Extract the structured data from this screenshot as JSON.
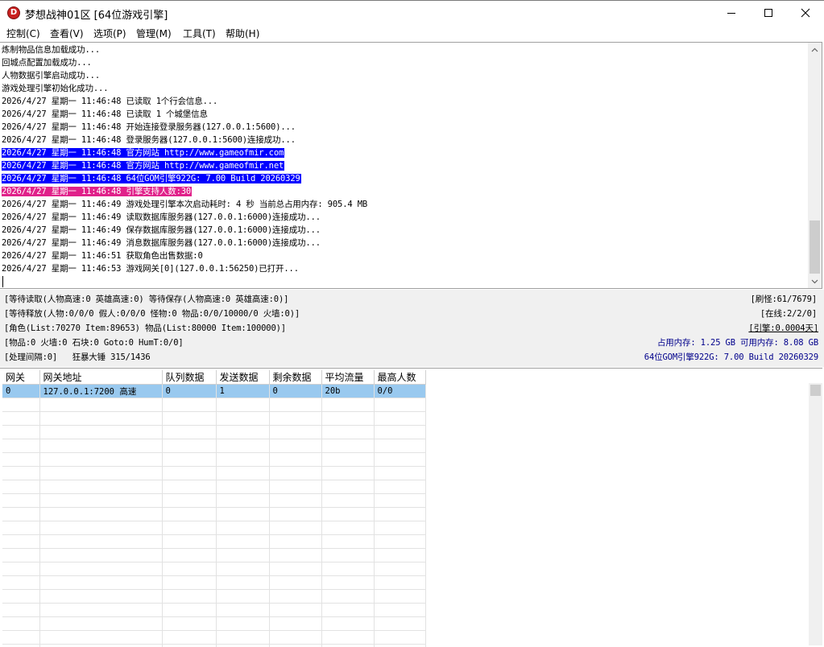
{
  "window": {
    "title": "梦想战神01区 [64位游戏引擎]",
    "icon": "app-logo-icon",
    "icon_letter": "D",
    "controls": [
      "minimize-icon",
      "maximize-icon",
      "close-icon"
    ]
  },
  "menu": [
    "控制(C)",
    "查看(V)",
    "选项(P)",
    "管理(M)",
    "工具(T)",
    "帮助(H)"
  ],
  "log": {
    "lines": [
      {
        "text": "炼制物品信息加载成功...",
        "hl": ""
      },
      {
        "text": "回城点配置加载成功...",
        "hl": ""
      },
      {
        "text": "人物数据引擎启动成功...",
        "hl": ""
      },
      {
        "text": "游戏处理引擎初始化成功...",
        "hl": ""
      },
      {
        "text": "2026/4/27 星期一 11:46:48 已读取 1个行会信息...",
        "hl": ""
      },
      {
        "text": "2026/4/27 星期一 11:46:48 已读取 1 个城堡信息",
        "hl": ""
      },
      {
        "text": "2026/4/27 星期一 11:46:48 开始连接登录服务器(127.0.0.1:5600)...",
        "hl": ""
      },
      {
        "text": "2026/4/27 星期一 11:46:48 登录服务器(127.0.0.1:5600)连接成功...",
        "hl": ""
      },
      {
        "text": "2026/4/27 星期一 11:46:48 官方网站 http://www.gameofmir.com",
        "hl": "blue"
      },
      {
        "text": "2026/4/27 星期一 11:46:48 官方网站 http://www.gameofmir.net",
        "hl": "blue"
      },
      {
        "text": "2026/4/27 星期一 11:46:48 64位GOM引擎922G: 7.00 Build 20260329",
        "hl": "blue"
      },
      {
        "text": "2026/4/27 星期一 11:46:48 引擎支持人数:30",
        "hl": "magenta"
      },
      {
        "text": "2026/4/27 星期一 11:46:49 游戏处理引擎本次启动耗时: 4 秒 当前总占用内存: 905.4 MB",
        "hl": ""
      },
      {
        "text": "2026/4/27 星期一 11:46:49 读取数据库服务器(127.0.0.1:6000)连接成功...",
        "hl": ""
      },
      {
        "text": "2026/4/27 星期一 11:46:49 保存数据库服务器(127.0.0.1:6000)连接成功...",
        "hl": ""
      },
      {
        "text": "2026/4/27 星期一 11:46:49 消息数据库服务器(127.0.0.1:6000)连接成功...",
        "hl": ""
      },
      {
        "text": "2026/4/27 星期一 11:46:51 获取角色出售数据:0",
        "hl": ""
      },
      {
        "text": "2026/4/27 星期一 11:46:53 游戏网关[0](127.0.0.1:56250)已打开...",
        "hl": ""
      }
    ]
  },
  "status": {
    "left": [
      "[等待读取(人物高速:0 英雄高速:0) 等待保存(人物高速:0 英雄高速:0)]",
      "[等待释放(人物:0/0/0 假人:0/0/0 怪物:0 物品:0/0/10000/0 火墙:0)]",
      "[角色(List:70270 Item:89653) 物品(List:80000 Item:100000)]",
      "[物品:0 火墙:0 石块:0 Goto:0 HumT:0/0]",
      "[处理间隔:0]   狂暴大锤 315/1436"
    ],
    "right": [
      "[刷怪:61/7679]",
      "[在线:2/2/0]",
      "[引擎:0.0004天]",
      "占用内存: 1.25 GB 可用内存: 8.08 GB",
      "64位GOM引擎922G: 7.00 Build 20260329"
    ]
  },
  "gateway_table": {
    "columns": [
      "网关",
      "网关地址",
      "队列数据",
      "发送数据",
      "剩余数据",
      "平均流量",
      "最高人数"
    ],
    "rows": [
      [
        "0",
        "127.0.0.1:7200 高速",
        "0",
        "1",
        "0",
        "20b",
        "0/0"
      ]
    ]
  },
  "colors": {
    "highlight_blue": "#0000ff",
    "highlight_magenta": "#e0218a",
    "selected_row": "#99c9ef",
    "status_blue_text": "#00008b"
  }
}
